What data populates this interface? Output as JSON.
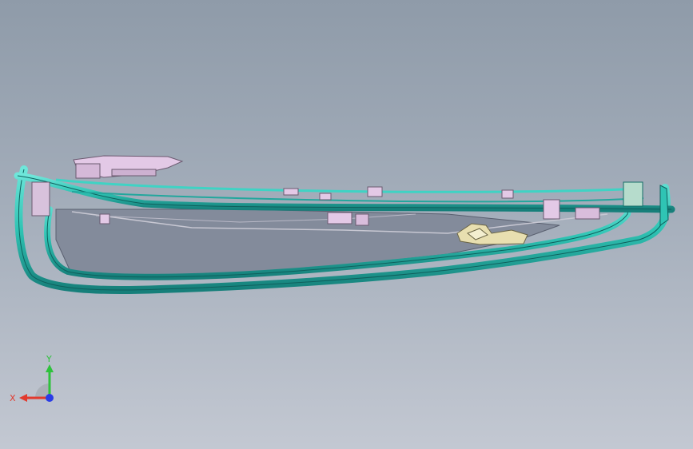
{
  "view": {
    "background_top": "#8f9ba9",
    "background_bottom": "#c3c8d2"
  },
  "model": {
    "frame_color": "#2fc4b4",
    "frame_dark": "#167f7a",
    "panel_color": "#848c9c",
    "bracket_color": "#e3c9e6",
    "latch_color": "#e8dfb0"
  },
  "triad": {
    "x_label": "X",
    "y_label": "Y",
    "x_color": "#e23a2e",
    "y_color": "#2ec23c",
    "z_color": "#2a3ce6"
  }
}
